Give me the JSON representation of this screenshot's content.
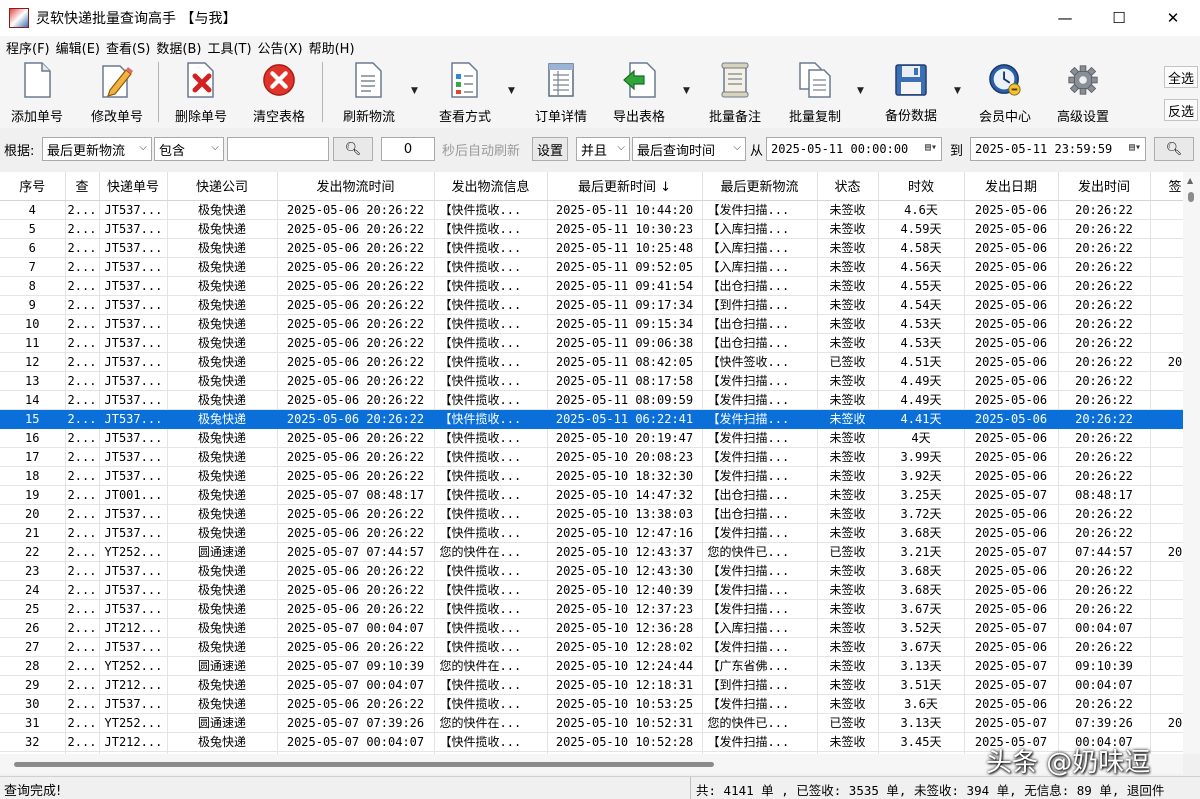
{
  "window": {
    "title": "灵软快递批量查询高手 【与我】",
    "minimize": "—",
    "maximize": "☐",
    "close": "✕"
  },
  "menu": [
    "程序(F)",
    "编辑(E)",
    "查看(S)",
    "数据(B)",
    "工具(T)",
    "公告(X)",
    "帮助(H)"
  ],
  "toolbar": {
    "buttons": [
      {
        "label": "添加单号",
        "icon": "add-document-icon"
      },
      {
        "label": "修改单号",
        "icon": "edit-pencil-icon"
      },
      {
        "label": "删除单号",
        "icon": "delete-document-icon"
      },
      {
        "label": "清空表格",
        "icon": "clear-red-x-icon"
      },
      {
        "label": "刷新物流",
        "icon": "refresh-document-icon"
      },
      {
        "label": "查看方式",
        "icon": "checklist-icon"
      },
      {
        "label": "订单详情",
        "icon": "order-detail-icon"
      },
      {
        "label": "导出表格",
        "icon": "export-green-arrow-icon"
      },
      {
        "label": "批量备注",
        "icon": "note-scroll-icon"
      },
      {
        "label": "批量复制",
        "icon": "copy-documents-icon"
      },
      {
        "label": "备份数据",
        "icon": "floppy-disk-icon"
      },
      {
        "label": "会员中心",
        "icon": "clock-member-icon"
      },
      {
        "label": "高级设置",
        "icon": "gear-icon"
      }
    ],
    "select_all": "全选",
    "invert_select": "反选"
  },
  "filter": {
    "basis_label": "根据:",
    "field": "最后更新物流",
    "condition": "包含",
    "keyword": "",
    "interval": "0",
    "auto_refresh": "秒后自动刷新",
    "settings": "设置",
    "logic": "并且",
    "time_field": "最后查询时间",
    "from_label": "从",
    "from_time": "2025-05-11 00:00:00",
    "to_label": "到",
    "to_time": "2025-05-11 23:59:59"
  },
  "table": {
    "headers": [
      "序号",
      "查",
      "快递单号",
      "快递公司",
      "发出物流时间",
      "发出物流信息",
      "最后更新时间 ↓",
      "最后更新物流",
      "状态",
      "时效",
      "发出日期",
      "发出时间",
      "签"
    ],
    "rows": [
      [
        "4",
        "2...",
        "JT537...",
        "极兔快递",
        "2025-05-06 20:26:22",
        "【快件揽收...",
        "2025-05-11 10:44:20",
        "【发件扫描...",
        "未签收",
        "4.6天",
        "2025-05-06",
        "20:26:22",
        ""
      ],
      [
        "5",
        "2...",
        "JT537...",
        "极兔快递",
        "2025-05-06 20:26:22",
        "【快件揽收...",
        "2025-05-11 10:30:23",
        "【入库扫描...",
        "未签收",
        "4.59天",
        "2025-05-06",
        "20:26:22",
        ""
      ],
      [
        "6",
        "2...",
        "JT537...",
        "极兔快递",
        "2025-05-06 20:26:22",
        "【快件揽收...",
        "2025-05-11 10:25:48",
        "【入库扫描...",
        "未签收",
        "4.58天",
        "2025-05-06",
        "20:26:22",
        ""
      ],
      [
        "7",
        "2...",
        "JT537...",
        "极兔快递",
        "2025-05-06 20:26:22",
        "【快件揽收...",
        "2025-05-11 09:52:05",
        "【入库扫描...",
        "未签收",
        "4.56天",
        "2025-05-06",
        "20:26:22",
        ""
      ],
      [
        "8",
        "2...",
        "JT537...",
        "极兔快递",
        "2025-05-06 20:26:22",
        "【快件揽收...",
        "2025-05-11 09:41:54",
        "【出仓扫描...",
        "未签收",
        "4.55天",
        "2025-05-06",
        "20:26:22",
        ""
      ],
      [
        "9",
        "2...",
        "JT537...",
        "极兔快递",
        "2025-05-06 20:26:22",
        "【快件揽收...",
        "2025-05-11 09:17:34",
        "【到件扫描...",
        "未签收",
        "4.54天",
        "2025-05-06",
        "20:26:22",
        ""
      ],
      [
        "10",
        "2...",
        "JT537...",
        "极兔快递",
        "2025-05-06 20:26:22",
        "【快件揽收...",
        "2025-05-11 09:15:34",
        "【出仓扫描...",
        "未签收",
        "4.53天",
        "2025-05-06",
        "20:26:22",
        ""
      ],
      [
        "11",
        "2...",
        "JT537...",
        "极兔快递",
        "2025-05-06 20:26:22",
        "【快件揽收...",
        "2025-05-11 09:06:38",
        "【出仓扫描...",
        "未签收",
        "4.53天",
        "2025-05-06",
        "20:26:22",
        ""
      ],
      [
        "12",
        "2...",
        "JT537...",
        "极兔快递",
        "2025-05-06 20:26:22",
        "【快件揽收...",
        "2025-05-11 08:42:05",
        "【快件签收...",
        "已签收",
        "4.51天",
        "2025-05-06",
        "20:26:22",
        "20"
      ],
      [
        "13",
        "2...",
        "JT537...",
        "极兔快递",
        "2025-05-06 20:26:22",
        "【快件揽收...",
        "2025-05-11 08:17:58",
        "【发件扫描...",
        "未签收",
        "4.49天",
        "2025-05-06",
        "20:26:22",
        ""
      ],
      [
        "14",
        "2...",
        "JT537...",
        "极兔快递",
        "2025-05-06 20:26:22",
        "【快件揽收...",
        "2025-05-11 08:09:59",
        "【发件扫描...",
        "未签收",
        "4.49天",
        "2025-05-06",
        "20:26:22",
        ""
      ],
      [
        "15",
        "2...",
        "JT537...",
        "极兔快递",
        "2025-05-06 20:26:22",
        "【快件揽收...",
        "2025-05-11 06:22:41",
        "【发件扫描...",
        "未签收",
        "4.41天",
        "2025-05-06",
        "20:26:22",
        ""
      ],
      [
        "16",
        "2...",
        "JT537...",
        "极兔快递",
        "2025-05-06 20:26:22",
        "【快件揽收...",
        "2025-05-10 20:19:47",
        "【发件扫描...",
        "未签收",
        "4天",
        "2025-05-06",
        "20:26:22",
        ""
      ],
      [
        "17",
        "2...",
        "JT537...",
        "极兔快递",
        "2025-05-06 20:26:22",
        "【快件揽收...",
        "2025-05-10 20:08:23",
        "【发件扫描...",
        "未签收",
        "3.99天",
        "2025-05-06",
        "20:26:22",
        ""
      ],
      [
        "18",
        "2...",
        "JT537...",
        "极兔快递",
        "2025-05-06 20:26:22",
        "【快件揽收...",
        "2025-05-10 18:32:30",
        "【发件扫描...",
        "未签收",
        "3.92天",
        "2025-05-06",
        "20:26:22",
        ""
      ],
      [
        "19",
        "2...",
        "JT001...",
        "极兔快递",
        "2025-05-07 08:48:17",
        "【快件揽收...",
        "2025-05-10 14:47:32",
        "【出仓扫描...",
        "未签收",
        "3.25天",
        "2025-05-07",
        "08:48:17",
        ""
      ],
      [
        "20",
        "2...",
        "JT537...",
        "极兔快递",
        "2025-05-06 20:26:22",
        "【快件揽收...",
        "2025-05-10 13:38:03",
        "【出仓扫描...",
        "未签收",
        "3.72天",
        "2025-05-06",
        "20:26:22",
        ""
      ],
      [
        "21",
        "2...",
        "JT537...",
        "极兔快递",
        "2025-05-06 20:26:22",
        "【快件揽收...",
        "2025-05-10 12:47:16",
        "【发件扫描...",
        "未签收",
        "3.68天",
        "2025-05-06",
        "20:26:22",
        ""
      ],
      [
        "22",
        "2...",
        "YT252...",
        "圆通速递",
        "2025-05-07 07:44:57",
        "您的快件在...",
        "2025-05-10 12:43:37",
        "您的快件已...",
        "已签收",
        "3.21天",
        "2025-05-07",
        "07:44:57",
        "20"
      ],
      [
        "23",
        "2...",
        "JT537...",
        "极兔快递",
        "2025-05-06 20:26:22",
        "【快件揽收...",
        "2025-05-10 12:43:30",
        "【发件扫描...",
        "未签收",
        "3.68天",
        "2025-05-06",
        "20:26:22",
        ""
      ],
      [
        "24",
        "2...",
        "JT537...",
        "极兔快递",
        "2025-05-06 20:26:22",
        "【快件揽收...",
        "2025-05-10 12:40:39",
        "【发件扫描...",
        "未签收",
        "3.68天",
        "2025-05-06",
        "20:26:22",
        ""
      ],
      [
        "25",
        "2...",
        "JT537...",
        "极兔快递",
        "2025-05-06 20:26:22",
        "【快件揽收...",
        "2025-05-10 12:37:23",
        "【发件扫描...",
        "未签收",
        "3.67天",
        "2025-05-06",
        "20:26:22",
        ""
      ],
      [
        "26",
        "2...",
        "JT212...",
        "极兔快递",
        "2025-05-07 00:04:07",
        "【快件揽收...",
        "2025-05-10 12:36:28",
        "【入库扫描...",
        "未签收",
        "3.52天",
        "2025-05-07",
        "00:04:07",
        ""
      ],
      [
        "27",
        "2...",
        "JT537...",
        "极兔快递",
        "2025-05-06 20:26:22",
        "【快件揽收...",
        "2025-05-10 12:28:02",
        "【发件扫描...",
        "未签收",
        "3.67天",
        "2025-05-06",
        "20:26:22",
        ""
      ],
      [
        "28",
        "2...",
        "YT252...",
        "圆通速递",
        "2025-05-07 09:10:39",
        "您的快件在...",
        "2025-05-10 12:24:44",
        "【广东省佛...",
        "未签收",
        "3.13天",
        "2025-05-07",
        "09:10:39",
        ""
      ],
      [
        "29",
        "2...",
        "JT212...",
        "极兔快递",
        "2025-05-07 00:04:07",
        "【快件揽收...",
        "2025-05-10 12:18:31",
        "【到件扫描...",
        "未签收",
        "3.51天",
        "2025-05-07",
        "00:04:07",
        ""
      ],
      [
        "30",
        "2...",
        "JT537...",
        "极兔快递",
        "2025-05-06 20:26:22",
        "【快件揽收...",
        "2025-05-10 10:53:25",
        "【发件扫描...",
        "未签收",
        "3.6天",
        "2025-05-06",
        "20:26:22",
        ""
      ],
      [
        "31",
        "2...",
        "YT252...",
        "圆通速递",
        "2025-05-07 07:39:26",
        "您的快件在...",
        "2025-05-10 10:52:31",
        "您的快件已...",
        "已签收",
        "3.13天",
        "2025-05-07",
        "07:39:26",
        "20"
      ],
      [
        "32",
        "2...",
        "JT212...",
        "极兔快递",
        "2025-05-07 00:04:07",
        "【快件揽收...",
        "2025-05-10 10:52:28",
        "【发件扫描...",
        "未签收",
        "3.45天",
        "2025-05-07",
        "00:04:07",
        ""
      ],
      [
        "33",
        "2...",
        "JT212...",
        "极兔快递",
        "2025-05-07 00:04:07",
        "【快件揽收...",
        "2025-05-10 10:49:47",
        "【发件扫描...",
        "未签收",
        "3.45天",
        "2025-05-07",
        "00:04:07",
        ""
      ]
    ],
    "selected_row": 11
  },
  "status": {
    "left": "查询完成!",
    "right": "共: 4141 单 , 已签收:  3535 单, 未签收:  394 单, 无信息: 89 单, 退回件"
  },
  "watermark": "头条 @奶味逗",
  "colors": {
    "selection": "#0a6fd8",
    "title_bar": "#ffffff",
    "window_bg": "#f0f0f0"
  }
}
